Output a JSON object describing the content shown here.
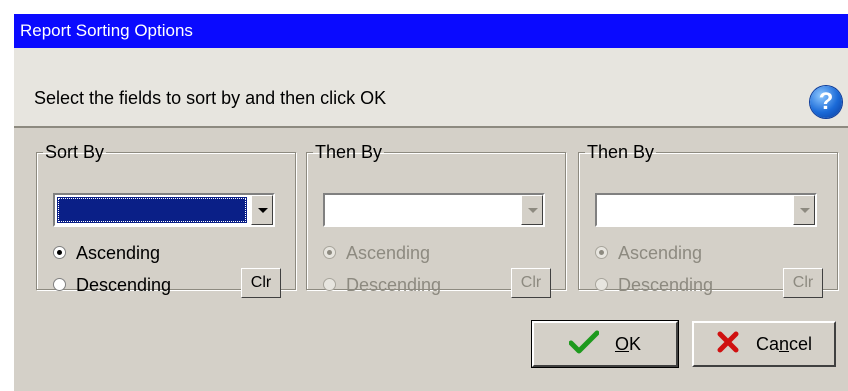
{
  "window": {
    "title": "Report Sorting Options"
  },
  "instruction": "Select the fields to sort by and then click OK",
  "help_icon": "question-icon",
  "groups": [
    {
      "legend": "Sort By",
      "enabled": true,
      "selected_field": "",
      "ascending": "Ascending",
      "descending": "Descending",
      "clear_label": "Clr",
      "order": "ascending"
    },
    {
      "legend": "Then By",
      "enabled": false,
      "selected_field": "",
      "ascending": "Ascending",
      "descending": "Descending",
      "clear_label": "Clr",
      "order": "ascending"
    },
    {
      "legend": "Then By",
      "enabled": false,
      "selected_field": "",
      "ascending": "Ascending",
      "descending": "Descending",
      "clear_label": "Clr",
      "order": "ascending"
    }
  ],
  "buttons": {
    "ok": {
      "prefix": "",
      "accel": "O",
      "rest": "K",
      "icon": "checkmark-icon"
    },
    "cancel": {
      "prefix": "Ca",
      "accel": "n",
      "rest": "cel",
      "icon": "x-icon"
    }
  },
  "colors": {
    "title_bar": "#0a0aff",
    "selection": "#0a1f87",
    "ok_check": "#1e9a1e",
    "cancel_x": "#d01010"
  }
}
